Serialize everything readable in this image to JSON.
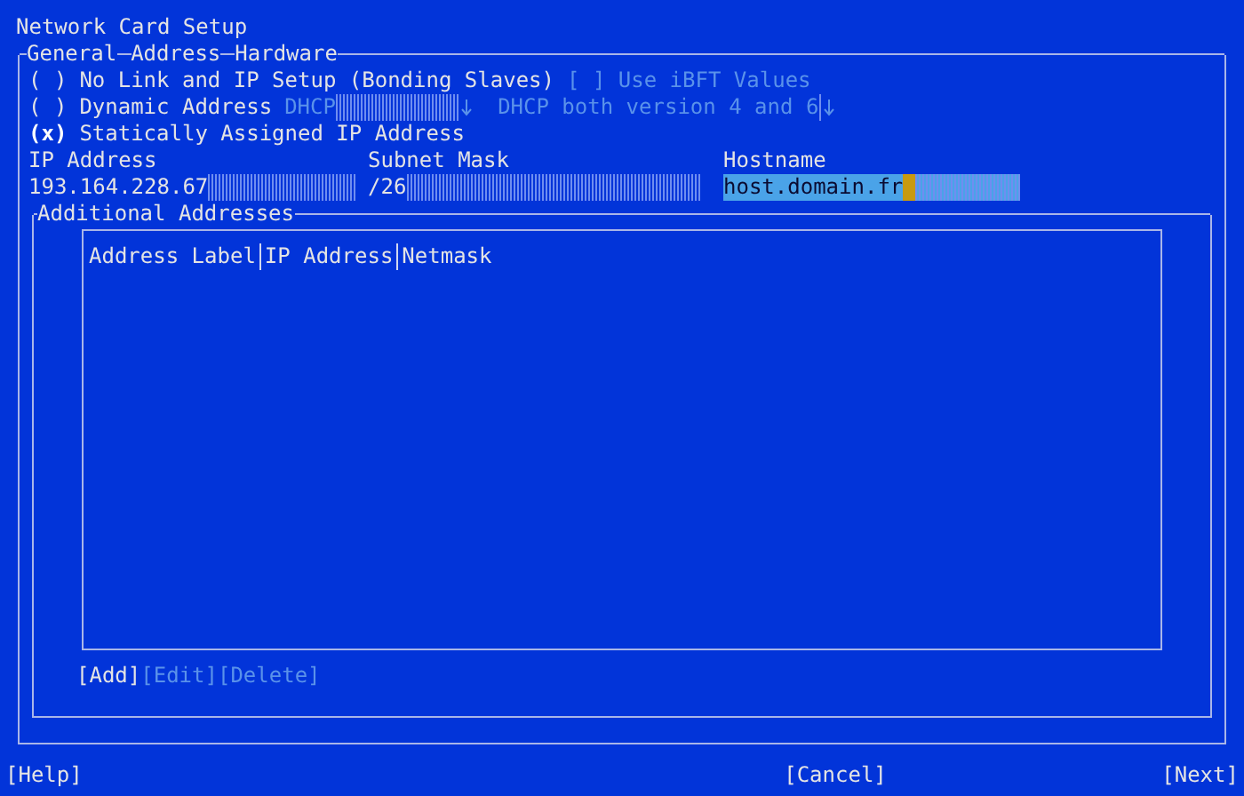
{
  "window": {
    "title": "Network Card Setup"
  },
  "tabs": [
    {
      "label": "General"
    },
    {
      "label": "Address"
    },
    {
      "label": "Hardware"
    }
  ],
  "options": [
    {
      "label": "No Link and IP Setup (Bonding Slaves)",
      "selected": false
    },
    {
      "label": "Dynamic Address",
      "selected": false
    },
    {
      "label": "Statically Assigned IP Address",
      "selected": true
    }
  ],
  "radio_marks": {
    "on": "(x)",
    "off": "( )"
  },
  "ibft": {
    "mark": "[ ]",
    "label": "Use iBFT Values",
    "checked": false,
    "disabled": true
  },
  "dynamic_combos": [
    {
      "value": "DHCP",
      "disabled": true
    },
    {
      "value": "DHCP both version 4 and 6",
      "disabled": true
    }
  ],
  "fields": [
    {
      "label": "IP Address",
      "value": "193.164.228.67",
      "focused": false
    },
    {
      "label": "Subnet Mask",
      "value": "/26",
      "focused": false
    },
    {
      "label": "Hostname",
      "value": "host.domain.fr",
      "focused": true
    }
  ],
  "additional": {
    "title": "Additional Addresses",
    "columns": [
      "Address Label",
      "IP Address",
      "Netmask"
    ],
    "buttons": [
      {
        "label": "[Add]",
        "disabled": false
      },
      {
        "label": "[Edit]",
        "disabled": true
      },
      {
        "label": "[Delete]",
        "disabled": true
      }
    ]
  },
  "footer": {
    "help": "[Help]",
    "cancel": "[Cancel]",
    "next": "[Next]"
  }
}
